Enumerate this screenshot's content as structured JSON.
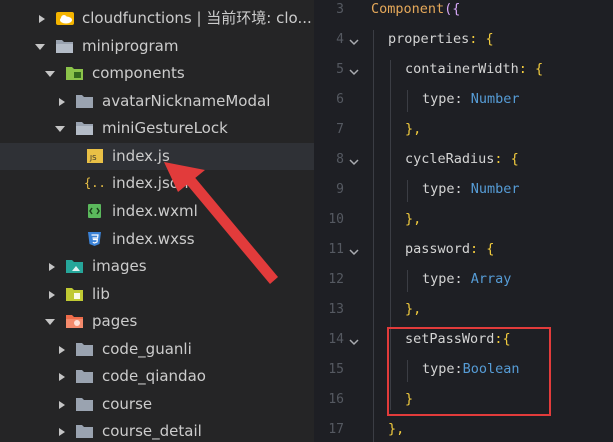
{
  "explorer": {
    "rows": [
      {
        "label": "cloudfunctions | 当前环境: clo...",
        "icon": "cloud-folder-icon"
      },
      {
        "label": "miniprogram",
        "icon": "folder-open-icon"
      },
      {
        "label": "components",
        "icon": "components-folder-icon"
      },
      {
        "label": "avatarNicknameModal",
        "icon": "folder-icon"
      },
      {
        "label": "miniGestureLock",
        "icon": "folder-open-icon"
      },
      {
        "label": "index.js",
        "icon": "js-file-icon"
      },
      {
        "label": "index.json",
        "icon": "json-file-icon"
      },
      {
        "label": "index.wxml",
        "icon": "wxml-file-icon"
      },
      {
        "label": "index.wxss",
        "icon": "wxss-file-icon"
      },
      {
        "label": "images",
        "icon": "images-folder-icon"
      },
      {
        "label": "lib",
        "icon": "lib-folder-icon"
      },
      {
        "label": "pages",
        "icon": "pages-folder-icon"
      },
      {
        "label": "code_guanli",
        "icon": "folder-icon"
      },
      {
        "label": "code_qiandao",
        "icon": "folder-icon"
      },
      {
        "label": "course",
        "icon": "folder-icon"
      },
      {
        "label": "course_detail",
        "icon": "folder-icon"
      }
    ]
  },
  "editor": {
    "lines": [
      {
        "num": "3",
        "keyword": "Component",
        "rest": "({"
      },
      {
        "num": "4",
        "prop": "properties",
        "rest": ": {"
      },
      {
        "num": "5",
        "prop": "containerWidth",
        "rest": ": {"
      },
      {
        "num": "6",
        "prop": "type",
        "rest": ": ",
        "type": "Number"
      },
      {
        "num": "7",
        "rest": "},"
      },
      {
        "num": "8",
        "prop": "cycleRadius",
        "rest": ": {"
      },
      {
        "num": "9",
        "prop": "type",
        "rest": ": ",
        "type": "Number"
      },
      {
        "num": "10",
        "rest": "},"
      },
      {
        "num": "11",
        "prop": "password",
        "rest": ": {"
      },
      {
        "num": "12",
        "prop": "type",
        "rest": ": ",
        "type": "Array"
      },
      {
        "num": "13",
        "rest": "},"
      },
      {
        "num": "14",
        "prop": "setPassWord",
        "rest": ":{"
      },
      {
        "num": "15",
        "prop": "type",
        "rest": ":",
        "type": "Boolean"
      },
      {
        "num": "16",
        "rest": "}"
      },
      {
        "num": "17",
        "rest": "},"
      }
    ]
  },
  "colors": {
    "annotation_red": "#e23b3b",
    "keyword": "#e5a85a",
    "type": "#569cd6",
    "brace": "#f1cb3e"
  }
}
